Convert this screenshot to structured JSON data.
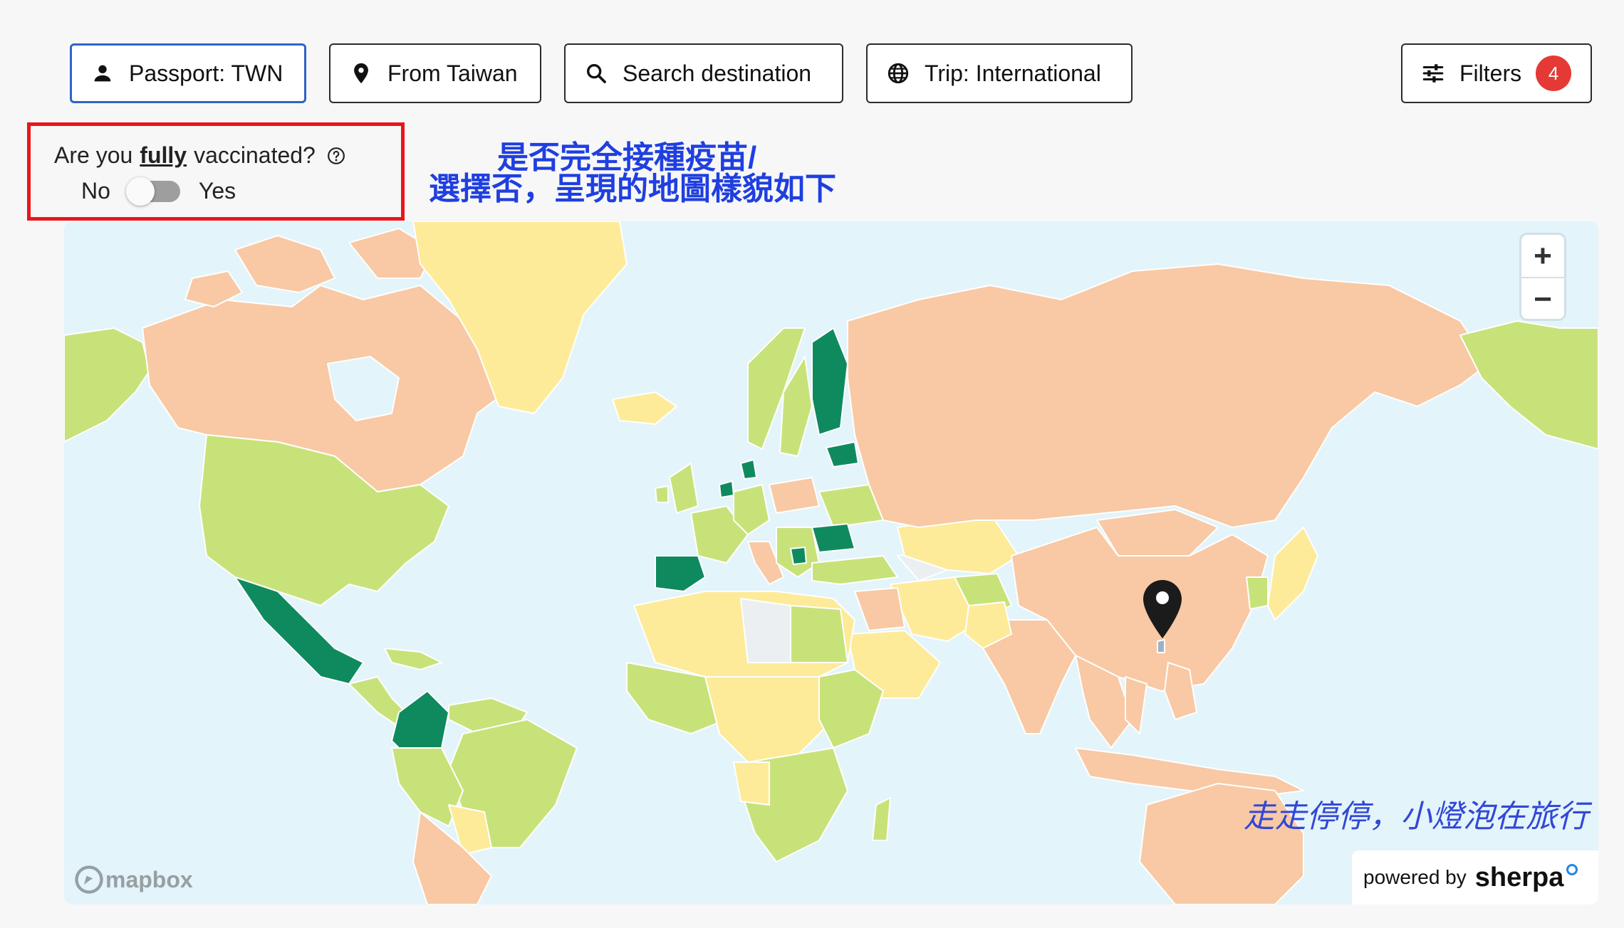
{
  "toolbar": {
    "passport_label": "Passport: TWN",
    "from_label": "From Taiwan",
    "search_label": "Search destination",
    "trip_label": "Trip: International",
    "filters_label": "Filters",
    "filters_count": "4"
  },
  "vaccination": {
    "question_prefix": "Are you",
    "question_emphasis": "fully",
    "question_suffix": "vaccinated?",
    "no_label": "No",
    "yes_label": "Yes",
    "selected": "No"
  },
  "annotation": {
    "line1": "是否完全接種疫苗/",
    "line2": "選擇否，呈現的地圖樣貌如下"
  },
  "map": {
    "zoom_in": "+",
    "zoom_out": "−",
    "attribution": "mapbox",
    "watermark": "走走停停，小燈泡在旅行",
    "powered_by": "powered by",
    "brand": "sherpa",
    "colors": {
      "ocean": "#e3f4fb",
      "restricted": "#f8c9a4",
      "partial": "#c8e27a",
      "moderate": "#fdeb9a",
      "open": "#0f8a5f",
      "no_data": "#eceff1",
      "border": "#ffffff"
    }
  }
}
